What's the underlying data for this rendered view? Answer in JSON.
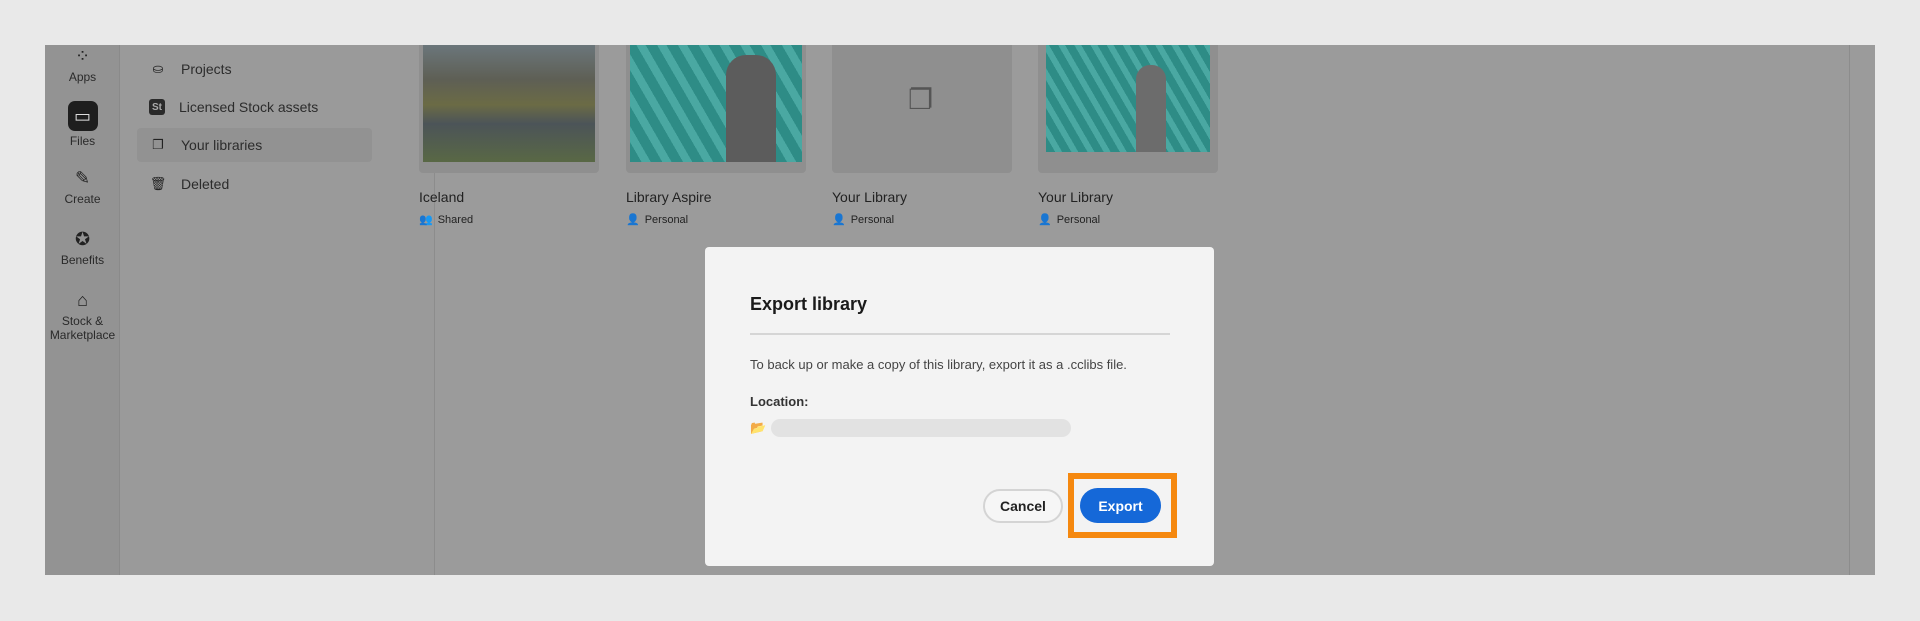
{
  "rail": [
    {
      "label": "Apps",
      "icon": "apps-icon"
    },
    {
      "label": "Files",
      "icon": "folder-icon",
      "active": true
    },
    {
      "label": "Create",
      "icon": "create-icon"
    },
    {
      "label": "Benefits",
      "icon": "award-icon"
    },
    {
      "label": "Stock &\nMarketplace",
      "icon": "store-icon"
    }
  ],
  "sidebar": [
    {
      "label": "Projects"
    },
    {
      "label": "Licensed Stock assets",
      "badge": "St"
    },
    {
      "label": "Your libraries",
      "active": true
    },
    {
      "label": "Deleted"
    }
  ],
  "cards": [
    {
      "title": "Iceland",
      "sub": "Shared"
    },
    {
      "title": "Library Aspire",
      "sub": "Personal"
    },
    {
      "title": "Your Library",
      "sub": "Personal"
    },
    {
      "title": "Your Library",
      "sub": "Personal"
    }
  ],
  "dialog": {
    "title": "Export library",
    "description": "To back up or make a copy of this library, export it as a .cclibs file.",
    "location_label": "Location:",
    "cancel": "Cancel",
    "export": "Export"
  },
  "colors": {
    "accent": "#1568d8",
    "highlight": "#f5880f"
  }
}
